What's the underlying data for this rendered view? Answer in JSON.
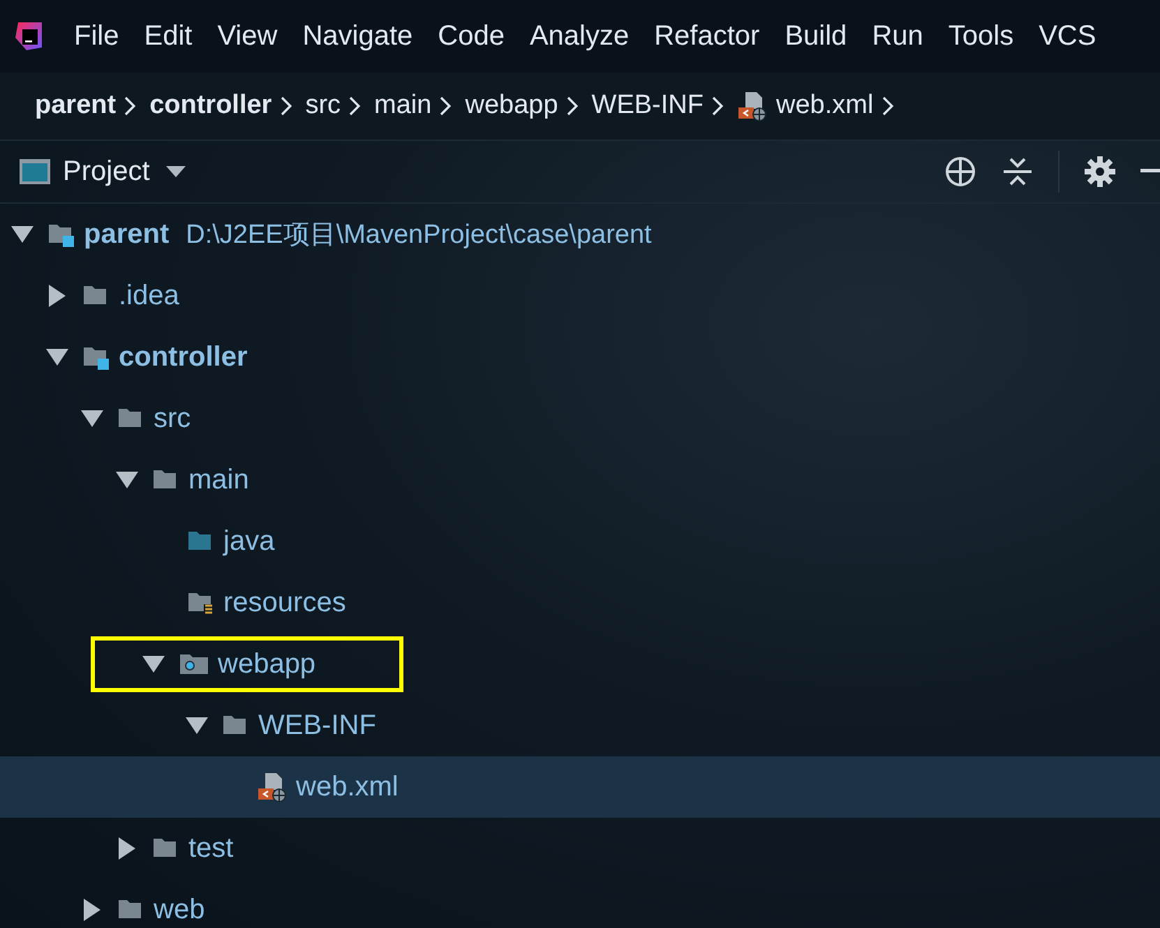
{
  "menu": [
    "File",
    "Edit",
    "View",
    "Navigate",
    "Code",
    "Analyze",
    "Refactor",
    "Build",
    "Run",
    "Tools",
    "VCS"
  ],
  "breadcrumbs": [
    {
      "label": "parent",
      "kind": "module"
    },
    {
      "label": "controller",
      "kind": "module"
    },
    {
      "label": "src",
      "kind": "folder"
    },
    {
      "label": "main",
      "kind": "folder"
    },
    {
      "label": "webapp",
      "kind": "folder"
    },
    {
      "label": "WEB-INF",
      "kind": "folder"
    },
    {
      "label": "web.xml",
      "kind": "xml"
    }
  ],
  "tool_window": {
    "title": "Project"
  },
  "tree": [
    {
      "label": "parent",
      "path": "D:\\J2EE项目\\MavenProject\\case\\parent",
      "kind": "module",
      "expanded": true,
      "selected": false,
      "annotated": false,
      "children": [
        {
          "label": ".idea",
          "kind": "folder",
          "expanded": false,
          "selected": false,
          "annotated": false
        },
        {
          "label": "controller",
          "kind": "module",
          "expanded": true,
          "selected": false,
          "annotated": false,
          "children": [
            {
              "label": "src",
              "kind": "folder",
              "expanded": true,
              "selected": false,
              "annotated": false,
              "children": [
                {
                  "label": "main",
                  "kind": "folder",
                  "expanded": true,
                  "selected": false,
                  "annotated": false,
                  "children": [
                    {
                      "label": "java",
                      "kind": "source",
                      "selected": false,
                      "annotated": false
                    },
                    {
                      "label": "resources",
                      "kind": "resources",
                      "selected": false,
                      "annotated": false
                    },
                    {
                      "label": "webapp",
                      "kind": "webroot",
                      "expanded": true,
                      "selected": false,
                      "annotated": true,
                      "children": [
                        {
                          "label": "WEB-INF",
                          "kind": "folder",
                          "expanded": true,
                          "selected": false,
                          "annotated": false,
                          "children": [
                            {
                              "label": "web.xml",
                              "kind": "xml",
                              "selected": true,
                              "annotated": false
                            }
                          ]
                        }
                      ]
                    }
                  ]
                },
                {
                  "label": "test",
                  "kind": "folder",
                  "expanded": false,
                  "selected": false,
                  "annotated": false
                }
              ]
            },
            {
              "label": "web",
              "kind": "folder",
              "expanded": false,
              "selected": false,
              "annotated": false
            }
          ]
        }
      ]
    }
  ]
}
